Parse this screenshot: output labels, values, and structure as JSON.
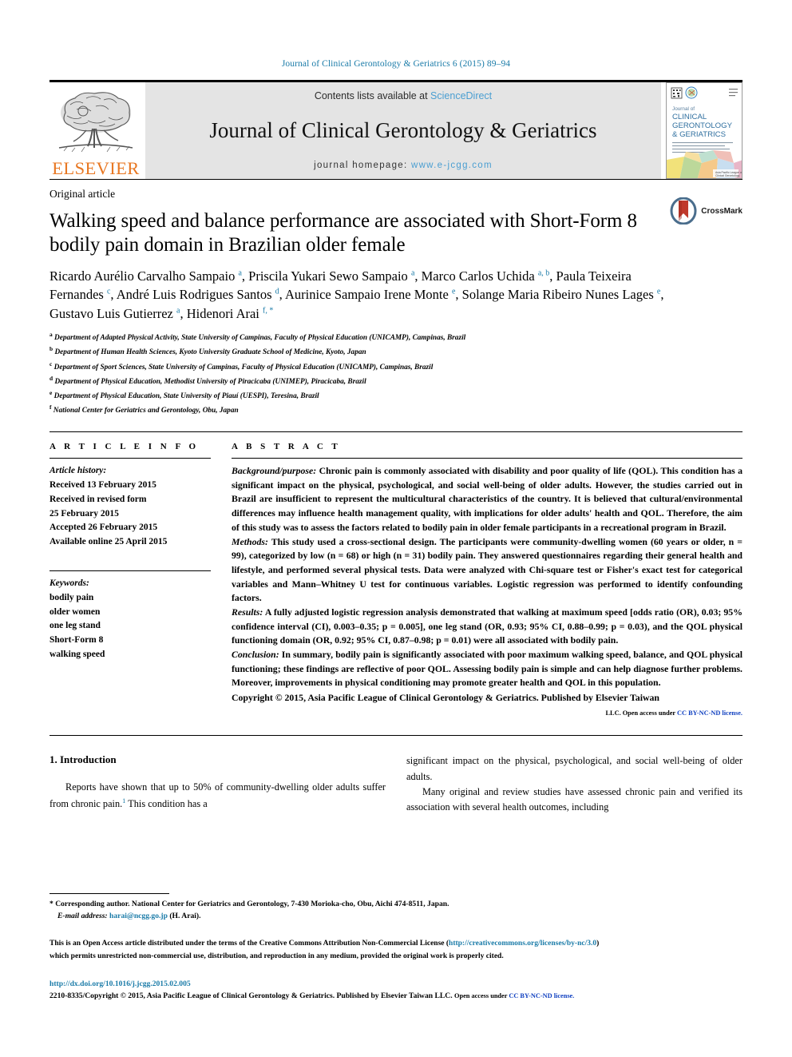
{
  "running_head": "Journal of Clinical Gerontology & Geriatrics 6 (2015) 89–94",
  "masthead": {
    "contents_prefix": "Contents lists available at ",
    "sciencedirect": "ScienceDirect",
    "journal_name": "Journal of Clinical Gerontology & Geriatrics",
    "homepage_prefix": "journal homepage: ",
    "homepage_url": "www.e-jcgg.com",
    "elsevier_word": "ELSEVIER",
    "cover_title_lines": [
      "Journal of",
      "CLINICAL",
      "GERONTOLOGY",
      "& GERIATRICS"
    ],
    "accent_link_color": "#4a9ed1",
    "elsevier_orange": "#e87722",
    "band_gray": "#e4e4e4"
  },
  "article": {
    "type": "Original article",
    "title": "Walking speed and balance performance are associated with Short-Form 8 bodily pain domain in Brazilian older female",
    "crossmark_label": "CrossMark",
    "authors_html": "Ricardo Aurélio Carvalho Sampaio <sup>a</sup>, Priscila Yukari Sewo Sampaio <sup>a</sup>, Marco Carlos Uchida <sup>a, b</sup>, Paula Teixeira Fernandes <sup>c</sup>, André Luis Rodrigues Santos <sup>d</sup>, Aurinice Sampaio Irene Monte <sup>e</sup>, Solange Maria Ribeiro Nunes Lages <sup>e</sup>, Gustavo Luis Gutierrez <sup>a</sup>, Hidenori Arai <sup>f,&nbsp;*</sup>",
    "affiliations": [
      {
        "mark": "a",
        "text": "Department of Adapted Physical Activity, State University of Campinas, Faculty of Physical Education (UNICAMP), Campinas, Brazil"
      },
      {
        "mark": "b",
        "text": "Department of Human Health Sciences, Kyoto University Graduate School of Medicine, Kyoto, Japan"
      },
      {
        "mark": "c",
        "text": "Department of Sport Sciences, State University of Campinas, Faculty of Physical Education (UNICAMP), Campinas, Brazil"
      },
      {
        "mark": "d",
        "text": "Department of Physical Education, Methodist University of Piracicaba (UNIMEP), Piracicaba, Brazil"
      },
      {
        "mark": "e",
        "text": "Department of Physical Education, State University of Piauí (UESPI), Teresina, Brazil"
      },
      {
        "mark": "f",
        "text": "National Center for Geriatrics and Gerontology, Obu, Japan"
      }
    ]
  },
  "article_info": {
    "heading": "A R T I C L E  I N F O",
    "history_label": "Article history:",
    "history_lines": [
      "Received 13 February 2015",
      "Received in revised form",
      "25 February 2015",
      "Accepted 26 February 2015",
      "Available online 25 April 2015"
    ],
    "keywords_label": "Keywords:",
    "keywords": [
      "bodily pain",
      "older women",
      "one leg stand",
      "Short-Form 8",
      "walking speed"
    ]
  },
  "abstract": {
    "heading": "A B S T R A C T",
    "sections": [
      {
        "label": "Background/purpose:",
        "text": " Chronic pain is commonly associated with disability and poor quality of life (QOL). This condition has a significant impact on the physical, psychological, and social well-being of older adults. However, the studies carried out in Brazil are insufficient to represent the multicultural characteristics of the country. It is believed that cultural/environmental differences may influence health management quality, with implications for older adults' health and QOL. Therefore, the aim of this study was to assess the factors related to bodily pain in older female participants in a recreational program in Brazil."
      },
      {
        "label": "Methods:",
        "text": " This study used a cross-sectional design. The participants were community-dwelling women (60 years or older, n = 99), categorized by low (n = 68) or high (n = 31) bodily pain. They answered questionnaires regarding their general health and lifestyle, and performed several physical tests. Data were analyzed with Chi-square test or Fisher's exact test for categorical variables and Mann–Whitney U test for continuous variables. Logistic regression was performed to identify confounding factors."
      },
      {
        "label": "Results:",
        "text": " A fully adjusted logistic regression analysis demonstrated that walking at maximum speed [odds ratio (OR), 0.03; 95% confidence interval (CI), 0.003–0.35; p = 0.005], one leg stand (OR, 0.93; 95% CI, 0.88–0.99; p = 0.03), and the QOL physical functioning domain (OR, 0.92; 95% CI, 0.87–0.98; p = 0.01) were all associated with bodily pain."
      },
      {
        "label": "Conclusion:",
        "text": " In summary, bodily pain is significantly associated with poor maximum walking speed, balance, and QOL physical functioning; these findings are reflective of poor QOL. Assessing bodily pain is simple and can help diagnose further problems. Moreover, improvements in physical conditioning may promote greater health and QOL in this population."
      }
    ],
    "copyright_line": "Copyright © 2015, Asia Pacific League of Clinical Gerontology & Geriatrics. Published by Elsevier Taiwan",
    "copyright_line2_prefix": "LLC. Open access under ",
    "copyright_license": "CC BY-NC-ND license."
  },
  "body": {
    "section_number_title": "1. Introduction",
    "left_paragraph_html": "Reports have shown that up to 50% of community-dwelling older adults suffer from chronic pain.<sup>1</sup> This condition has a",
    "right_paragraph_1": "significant impact on the physical, psychological, and social well-being of older adults.",
    "right_paragraph_2": "Many original and review studies have assessed chronic pain and verified its association with several health outcomes, including"
  },
  "footnotes": {
    "corresponding": "* Corresponding author. National Center for Geriatrics and Gerontology, 7-430 Morioka-cho, Obu, Aichi 474-8511, Japan.",
    "email_label": "E-mail address:",
    "email": "harai@ncgg.go.jp",
    "email_suffix": "(H. Arai).",
    "open_access_1_prefix": "This is an Open Access article distributed under the terms of the Creative Commons Attribution Non-Commercial License (",
    "open_access_url": "http://creativecommons.org/licenses/by-nc/3.0",
    "open_access_1_suffix": ")",
    "open_access_2": "which permits unrestricted non-commercial use, distribution, and reproduction in any medium, provided the original work is properly cited.",
    "doi": "http://dx.doi.org/10.1016/j.jcgg.2015.02.005",
    "issn_line": "2210-8335/Copyright © 2015, Asia Pacific League of Clinical Gerontology & Geriatrics. Published by Elsevier Taiwan LLC. ",
    "issn_oa": "Open access under ",
    "issn_license": "CC BY-NC-ND license."
  }
}
